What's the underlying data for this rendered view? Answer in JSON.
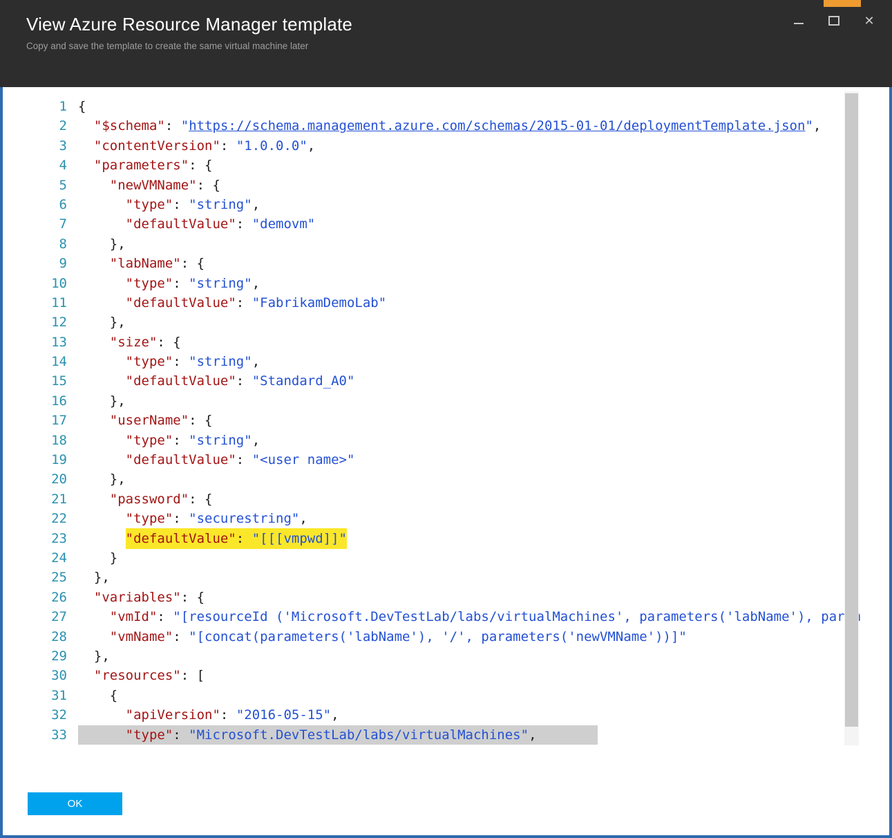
{
  "window": {
    "title": "View Azure Resource Manager template",
    "subtitle": "Copy and save the template to create the same virtual machine later",
    "icons": {
      "close_glyph": "✕"
    }
  },
  "colors": {
    "accent_border": "#2e6bb0",
    "titlebar_bg": "#2d2d2d",
    "ok_button": "#00a2ed",
    "line_number": "#2b91af",
    "json_key": "#a31515",
    "json_string": "#2451d3",
    "highlight_yellow": "#fbe72a",
    "highlight_gray": "#cfcfcf",
    "orange_marker": "#ee9b31"
  },
  "footer": {
    "ok_label": "OK"
  },
  "editor": {
    "lines": [
      {
        "n": 1,
        "tokens": [
          [
            "p",
            "{"
          ]
        ]
      },
      {
        "n": 2,
        "tokens": [
          [
            "p",
            "  "
          ],
          [
            "k",
            "\"$schema\""
          ],
          [
            "p",
            ": "
          ],
          [
            "s",
            "\""
          ],
          [
            "a",
            "https://schema.management.azure.com/schemas/2015-01-01/deploymentTemplate.json"
          ],
          [
            "s",
            "\""
          ],
          [
            "p",
            ","
          ]
        ]
      },
      {
        "n": 3,
        "tokens": [
          [
            "p",
            "  "
          ],
          [
            "k",
            "\"contentVersion\""
          ],
          [
            "p",
            ": "
          ],
          [
            "s",
            "\"1.0.0.0\""
          ],
          [
            "p",
            ","
          ]
        ]
      },
      {
        "n": 4,
        "tokens": [
          [
            "p",
            "  "
          ],
          [
            "k",
            "\"parameters\""
          ],
          [
            "p",
            ": {"
          ]
        ]
      },
      {
        "n": 5,
        "tokens": [
          [
            "p",
            "    "
          ],
          [
            "k",
            "\"newVMName\""
          ],
          [
            "p",
            ": {"
          ]
        ]
      },
      {
        "n": 6,
        "tokens": [
          [
            "p",
            "      "
          ],
          [
            "k",
            "\"type\""
          ],
          [
            "p",
            ": "
          ],
          [
            "s",
            "\"string\""
          ],
          [
            "p",
            ","
          ]
        ]
      },
      {
        "n": 7,
        "tokens": [
          [
            "p",
            "      "
          ],
          [
            "k",
            "\"defaultValue\""
          ],
          [
            "p",
            ": "
          ],
          [
            "s",
            "\"demovm\""
          ]
        ]
      },
      {
        "n": 8,
        "tokens": [
          [
            "p",
            "    },"
          ]
        ]
      },
      {
        "n": 9,
        "tokens": [
          [
            "p",
            "    "
          ],
          [
            "k",
            "\"labName\""
          ],
          [
            "p",
            ": {"
          ]
        ]
      },
      {
        "n": 10,
        "tokens": [
          [
            "p",
            "      "
          ],
          [
            "k",
            "\"type\""
          ],
          [
            "p",
            ": "
          ],
          [
            "s",
            "\"string\""
          ],
          [
            "p",
            ","
          ]
        ]
      },
      {
        "n": 11,
        "tokens": [
          [
            "p",
            "      "
          ],
          [
            "k",
            "\"defaultValue\""
          ],
          [
            "p",
            ": "
          ],
          [
            "s",
            "\"FabrikamDemoLab\""
          ]
        ]
      },
      {
        "n": 12,
        "tokens": [
          [
            "p",
            "    },"
          ]
        ]
      },
      {
        "n": 13,
        "tokens": [
          [
            "p",
            "    "
          ],
          [
            "k",
            "\"size\""
          ],
          [
            "p",
            ": {"
          ]
        ]
      },
      {
        "n": 14,
        "tokens": [
          [
            "p",
            "      "
          ],
          [
            "k",
            "\"type\""
          ],
          [
            "p",
            ": "
          ],
          [
            "s",
            "\"string\""
          ],
          [
            "p",
            ","
          ]
        ]
      },
      {
        "n": 15,
        "tokens": [
          [
            "p",
            "      "
          ],
          [
            "k",
            "\"defaultValue\""
          ],
          [
            "p",
            ": "
          ],
          [
            "s",
            "\"Standard_A0\""
          ]
        ]
      },
      {
        "n": 16,
        "tokens": [
          [
            "p",
            "    },"
          ]
        ]
      },
      {
        "n": 17,
        "tokens": [
          [
            "p",
            "    "
          ],
          [
            "k",
            "\"userName\""
          ],
          [
            "p",
            ": {"
          ]
        ]
      },
      {
        "n": 18,
        "tokens": [
          [
            "p",
            "      "
          ],
          [
            "k",
            "\"type\""
          ],
          [
            "p",
            ": "
          ],
          [
            "s",
            "\"string\""
          ],
          [
            "p",
            ","
          ]
        ]
      },
      {
        "n": 19,
        "tokens": [
          [
            "p",
            "      "
          ],
          [
            "k",
            "\"defaultValue\""
          ],
          [
            "p",
            ": "
          ],
          [
            "s",
            "\"<user name>\""
          ]
        ]
      },
      {
        "n": 20,
        "tokens": [
          [
            "p",
            "    },"
          ]
        ]
      },
      {
        "n": 21,
        "tokens": [
          [
            "p",
            "    "
          ],
          [
            "k",
            "\"password\""
          ],
          [
            "p",
            ": {"
          ]
        ]
      },
      {
        "n": 22,
        "tokens": [
          [
            "p",
            "      "
          ],
          [
            "k",
            "\"type\""
          ],
          [
            "p",
            ": "
          ],
          [
            "s",
            "\"securestring\""
          ],
          [
            "p",
            ","
          ]
        ]
      },
      {
        "n": 23,
        "tokens": [
          [
            "p",
            "      "
          ],
          [
            "k",
            "\"defaultValue\"",
            "y"
          ],
          [
            "p",
            ": ",
            "y"
          ],
          [
            "s",
            "\"[[[vmpwd]]\"",
            "y"
          ]
        ]
      },
      {
        "n": 24,
        "tokens": [
          [
            "p",
            "    }"
          ]
        ]
      },
      {
        "n": 25,
        "tokens": [
          [
            "p",
            "  },"
          ]
        ]
      },
      {
        "n": 26,
        "tokens": [
          [
            "p",
            "  "
          ],
          [
            "k",
            "\"variables\""
          ],
          [
            "p",
            ": {"
          ]
        ]
      },
      {
        "n": 27,
        "tokens": [
          [
            "p",
            "    "
          ],
          [
            "k",
            "\"vmId\""
          ],
          [
            "p",
            ": "
          ],
          [
            "s",
            "\"[resourceId ('Microsoft.DevTestLab/labs/virtualMachines', parameters('labName'), param"
          ]
        ]
      },
      {
        "n": 28,
        "tokens": [
          [
            "p",
            "    "
          ],
          [
            "k",
            "\"vmName\""
          ],
          [
            "p",
            ": "
          ],
          [
            "s",
            "\"[concat(parameters('labName'), '/', parameters('newVMName'))]\""
          ]
        ]
      },
      {
        "n": 29,
        "tokens": [
          [
            "p",
            "  },"
          ]
        ]
      },
      {
        "n": 30,
        "tokens": [
          [
            "p",
            "  "
          ],
          [
            "k",
            "\"resources\""
          ],
          [
            "p",
            ": ["
          ]
        ]
      },
      {
        "n": 31,
        "tokens": [
          [
            "p",
            "    {"
          ]
        ]
      },
      {
        "n": 32,
        "tokens": [
          [
            "p",
            "      "
          ],
          [
            "k",
            "\"apiVersion\""
          ],
          [
            "p",
            ": "
          ],
          [
            "s",
            "\"2016-05-15\""
          ],
          [
            "p",
            ","
          ]
        ]
      },
      {
        "n": 33,
        "bg": "gray",
        "tokens": [
          [
            "p",
            "      "
          ],
          [
            "k",
            "\"type\""
          ],
          [
            "p",
            ": "
          ],
          [
            "s",
            "\"Microsoft.DevTestLab/labs/virtualMachines\""
          ],
          [
            "p",
            ","
          ]
        ]
      }
    ]
  }
}
